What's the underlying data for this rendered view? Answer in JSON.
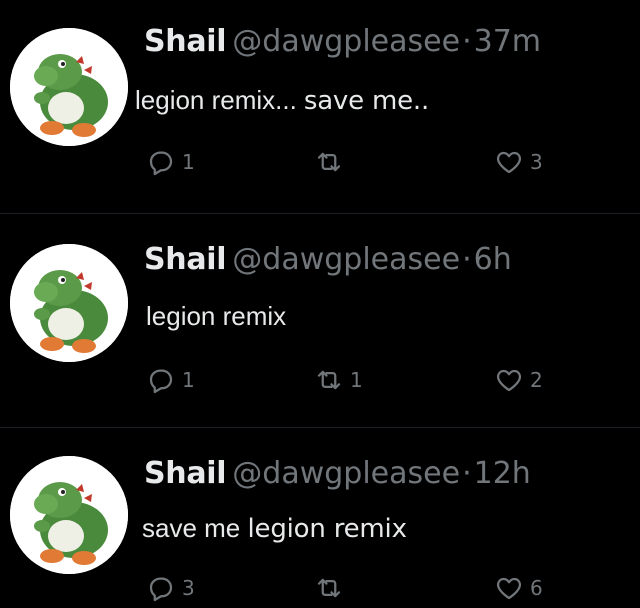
{
  "colors": {
    "background": "#000000",
    "primary_text": "#e7e9ea",
    "secondary_text": "#71767b",
    "divider": "#1c1f23"
  },
  "tweets": [
    {
      "name": "Shail",
      "handle": "@dawgpleasee",
      "separator": "·",
      "time": "37m",
      "text": "legion remix...",
      "text_extra": "save me..",
      "reply_count": "1",
      "retweet_count": "",
      "like_count": "3",
      "avatar_icon": "green-dinosaur-avatar"
    },
    {
      "name": "Shail",
      "handle": "@dawgpleasee",
      "separator": "·",
      "time": "6h",
      "text": "legion remix",
      "text_extra": "",
      "reply_count": "1",
      "retweet_count": "1",
      "like_count": "2",
      "avatar_icon": "green-dinosaur-avatar"
    },
    {
      "name": "Shail",
      "handle": "@dawgpleasee",
      "separator": "·",
      "time": "12h",
      "text": "save me",
      "text_extra": "legion remix",
      "reply_count": "3",
      "retweet_count": "",
      "like_count": "6",
      "avatar_icon": "green-dinosaur-avatar"
    }
  ],
  "icons": {
    "reply": "reply-icon",
    "retweet": "retweet-icon",
    "like": "heart-icon"
  }
}
